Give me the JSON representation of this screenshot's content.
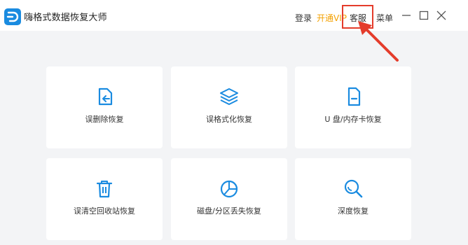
{
  "app": {
    "title": "嗨格式数据恢复大师"
  },
  "header": {
    "login_label": "登录",
    "vip_label": "开通VIP",
    "service_label": "客服",
    "menu_label": "菜单"
  },
  "cards": [
    {
      "label": "误删除恢复",
      "icon": "file-undo-icon"
    },
    {
      "label": "误格式化恢复",
      "icon": "layers-icon"
    },
    {
      "label": "U 盘/内存卡恢复",
      "icon": "sd-card-icon"
    },
    {
      "label": "误清空回收站恢复",
      "icon": "trash-icon"
    },
    {
      "label": "磁盘/分区丢失恢复",
      "icon": "pie-chart-icon"
    },
    {
      "label": "深度恢复",
      "icon": "magnifier-icon"
    }
  ],
  "colors": {
    "accent": "#1a8be0",
    "vip": "#f4a100",
    "annotation": "#e43c2b",
    "background": "#f3f4f6"
  }
}
